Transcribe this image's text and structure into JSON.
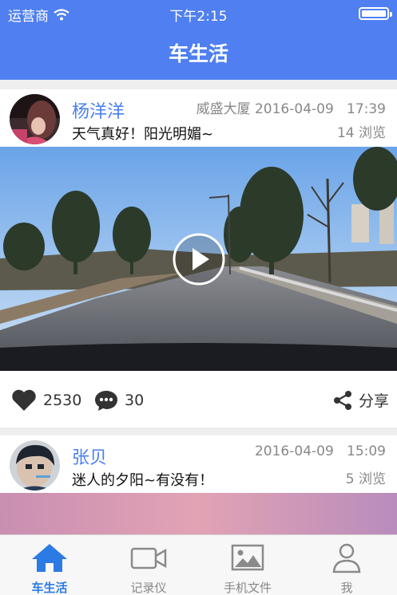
{
  "status_bar": {
    "carrier": "运营商",
    "time": "下午2:15"
  },
  "nav": {
    "title": "车生活"
  },
  "posts": [
    {
      "author": "杨洋洋",
      "content": "天气真好！阳光明媚~",
      "location_date": "威盛大厦 2016-04-09",
      "time": "17:39",
      "views": "14 浏览",
      "likes": "2530",
      "comments": "30",
      "share_label": "分享"
    },
    {
      "author": "张贝",
      "content": "迷人的夕阳~有没有！",
      "location_date": "2016-04-09",
      "time": "15:09",
      "views": "5 浏览"
    }
  ],
  "tabs": [
    {
      "label": "车生活",
      "icon": "home-icon"
    },
    {
      "label": "记录仪",
      "icon": "video-camera-icon"
    },
    {
      "label": "手机文件",
      "icon": "image-icon"
    },
    {
      "label": "我",
      "icon": "user-icon"
    }
  ],
  "colors": {
    "accent": "#4f7ff0",
    "tab_active": "#2c7be5",
    "name": "#4a7ff0"
  }
}
